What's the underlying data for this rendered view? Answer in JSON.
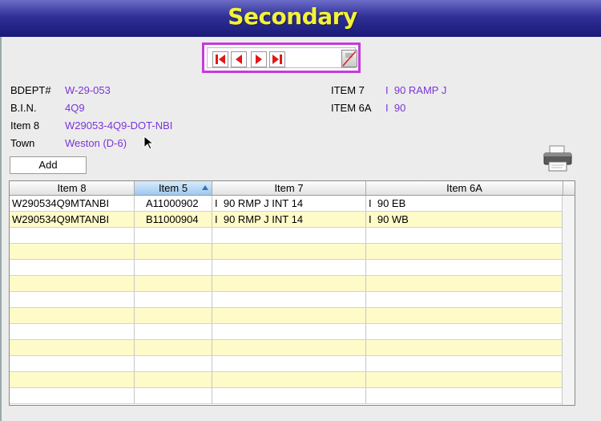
{
  "window": {
    "title": "Secondary"
  },
  "nav": {
    "buttons": [
      {
        "name": "first-record-button",
        "icon": "first-icon"
      },
      {
        "name": "previous-record-button",
        "icon": "previous-icon"
      },
      {
        "name": "next-record-button",
        "icon": "next-icon"
      },
      {
        "name": "last-record-button",
        "icon": "last-icon"
      }
    ],
    "edit_icon": "no-edit-icon",
    "accent_color": "#c43cd8",
    "arrow_color": "#e01818"
  },
  "fields": {
    "bdept_label": "BDEPT#",
    "bdept_value": "W-29-053",
    "bin_label": "B.I.N.",
    "bin_value": "4Q9",
    "item8_label": "Item 8",
    "item8_value": "W29053-4Q9-DOT-NBI",
    "town_label": "Town",
    "town_value": "Weston (D-6)",
    "item7_label": "ITEM 7",
    "item7_value": "I  90 RAMP J",
    "item6a_label": "ITEM 6A",
    "item6a_value": "I  90",
    "value_color": "#7b35d8"
  },
  "actions": {
    "add_label": "Add",
    "print_icon": "printer-icon"
  },
  "table": {
    "columns": [
      "Item 8",
      "Item 5",
      "Item 7",
      "Item 6A"
    ],
    "sorted_column": "Item 5",
    "rows": [
      [
        "W290534Q9MTANBI",
        "A11000902",
        "I  90 RMP J INT 14",
        "I  90 EB"
      ],
      [
        "W290534Q9MTANBI",
        "B11000904",
        "I  90 RMP J INT 14",
        "I  90 WB"
      ]
    ],
    "row_alt_color": "#fefbc8"
  }
}
